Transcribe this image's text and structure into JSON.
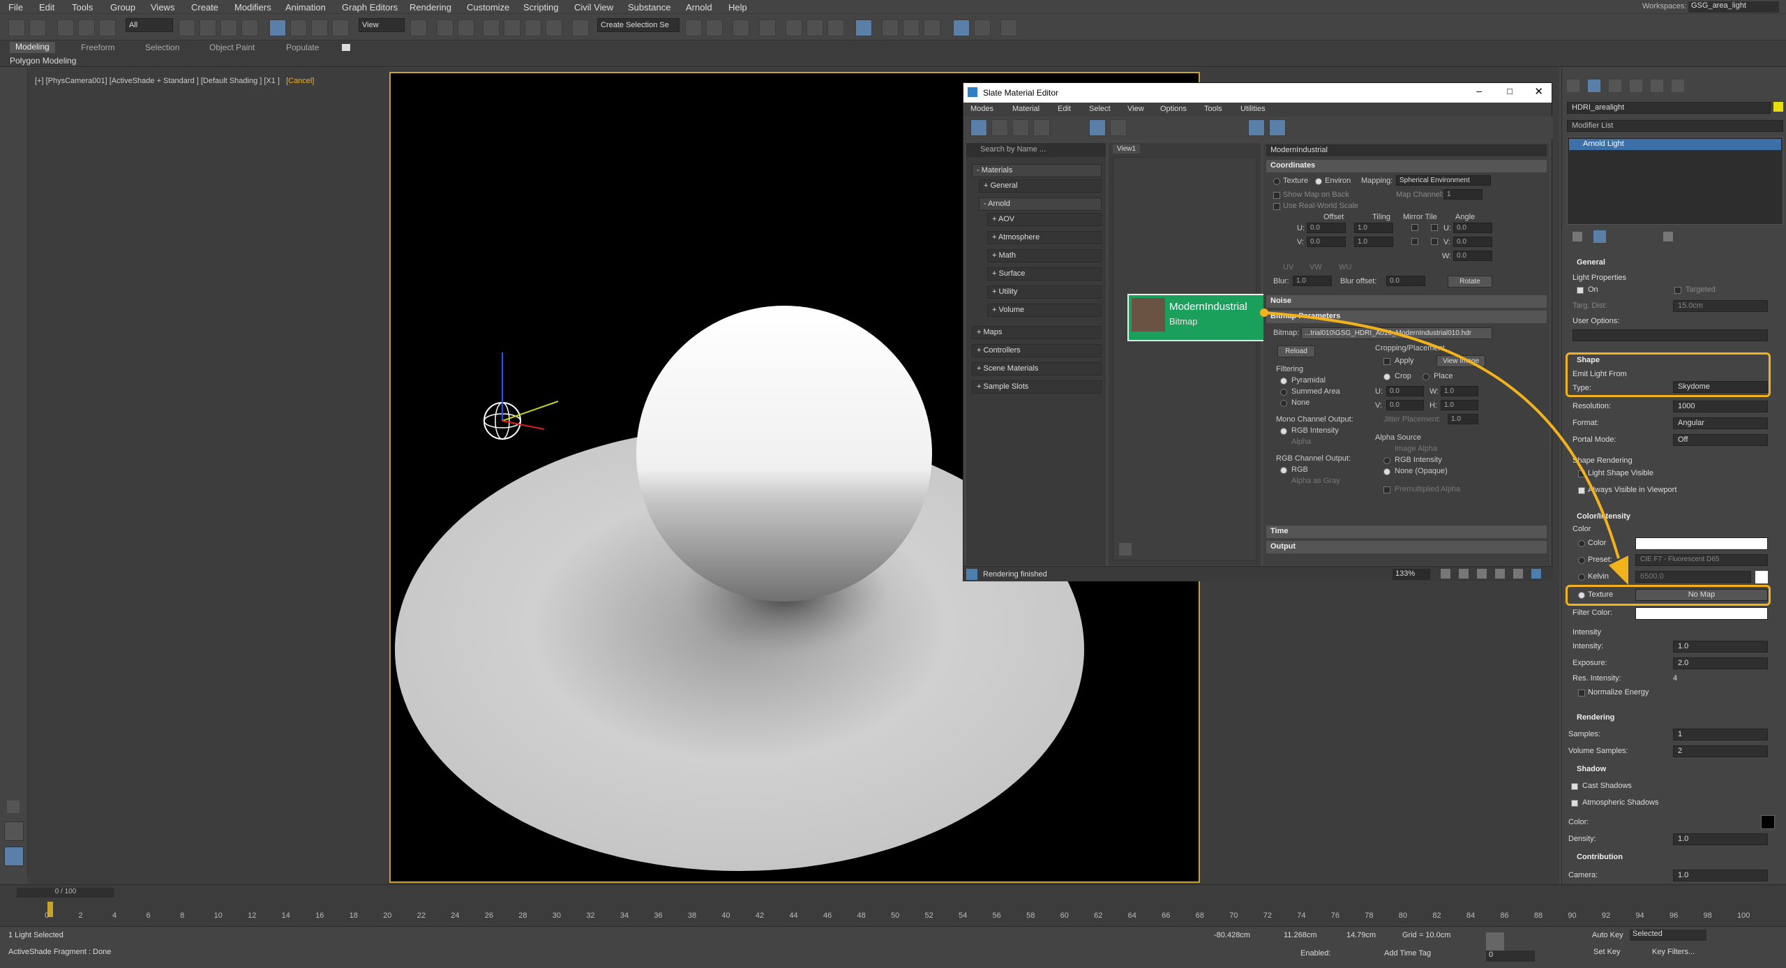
{
  "menu": [
    "File",
    "Edit",
    "Tools",
    "Group",
    "Views",
    "Create",
    "Modifiers",
    "Animation",
    "Graph Editors",
    "Rendering",
    "Customize",
    "Scripting",
    "Civil View",
    "Substance",
    "Arnold",
    "Help"
  ],
  "workspace": {
    "label": "Workspaces:",
    "value": "GSG_area_light"
  },
  "toolbar": {
    "filter": "All",
    "view": "View",
    "selection_set": "Create Selection Se"
  },
  "ribbon": {
    "tabs": [
      "Modeling",
      "Freeform",
      "Selection",
      "Object Paint",
      "Populate"
    ],
    "sub": "Polygon Modeling"
  },
  "viewport": {
    "label": "[+] [PhysCamera001] [ActiveShade + Standard ] [Default Shading ] [X1 ]",
    "cancel": "[Cancel]"
  },
  "sme": {
    "title": "Slate Material Editor",
    "menus": [
      "Modes",
      "Material",
      "Edit",
      "Select",
      "View",
      "Options",
      "Tools",
      "Utilities"
    ],
    "search": "Search by Name ...",
    "view_tab": "View1",
    "browser": {
      "root": "- Materials",
      "items": [
        "+ General",
        "- Arnold",
        "+ AOV",
        "+ Atmosphere",
        "+ Math",
        "+ Surface",
        "+ Utility",
        "+ Volume",
        "+ Maps",
        "+ Controllers",
        "+ Scene Materials",
        "+ Sample Slots"
      ]
    },
    "node": {
      "name": "ModernIndustrial",
      "type": "Bitmap"
    },
    "props": {
      "header": "ModernIndustrial",
      "coordinates": "Coordinates",
      "texture": "Texture",
      "environ": "Environ",
      "mapping_label": "Mapping:",
      "mapping": "Spherical Environment",
      "show_map": "Show Map on Back",
      "map_channel": "Map Channel:",
      "map_channel_val": "1",
      "real_world": "Use Real-World Scale",
      "cols": [
        "Offset",
        "Tiling",
        "Mirror Tile",
        "Angle"
      ],
      "u": "U:",
      "v": "V:",
      "w": "W:",
      "u_off": "0.0",
      "v_off": "0.0",
      "u_til": "1.0",
      "v_til": "1.0",
      "u_ang": "0.0",
      "v_ang": "0.0",
      "w_ang": "0.0",
      "uv": "UV",
      "vw": "VW",
      "wu": "WU",
      "blur": "Blur:",
      "blur_val": "1.0",
      "blur_off": "Blur offset:",
      "blur_off_val": "0.0",
      "rotate": "Rotate",
      "noise": "Noise",
      "bitmap_params": "Bitmap Parameters",
      "bitmap": "Bitmap:",
      "bitmap_path": "...trial010\\GSG_HDRI_A010_ModernIndustrial010.hdr",
      "reload": "Reload",
      "cropping": "Cropping/Placement",
      "apply": "Apply",
      "view_image": "View Image",
      "crop": "Crop",
      "place": "Place",
      "cu": "U:",
      "cu_val": "0.0",
      "cw": "W:",
      "cw_val": "1.0",
      "cv": "V:",
      "cv_val": "0.0",
      "ch": "H:",
      "ch_val": "1.0",
      "jitter": "Jitter Placement:",
      "jitter_val": "1.0",
      "filtering": "Filtering",
      "pyramidal": "Pyramidal",
      "summed": "Summed Area",
      "none": "None",
      "mono": "Mono Channel Output:",
      "rgb_int": "RGB Intensity",
      "alpha": "Alpha",
      "rgb_out": "RGB Channel Output:",
      "rgb": "RGB",
      "alpha_gray": "Alpha as Gray",
      "alpha_src": "Alpha Source",
      "image_alpha": "Image Alpha",
      "rgb_int2": "RGB Intensity",
      "none_opaque": "None (Opaque)",
      "premult": "Premultiplied Alpha",
      "time": "Time",
      "output": "Output"
    },
    "status": "Rendering finished",
    "zoom": "133%"
  },
  "cmd": {
    "object": "HDRI_arealight",
    "modifier_list": "Modifier List",
    "stack_item": "Arnold Light",
    "general": "General",
    "light_props": "Light Properties",
    "on": "On",
    "targeted": "Targeted",
    "targ_dist": "Targ. Dist:",
    "targ_dist_val": "15.0cm",
    "user_options": "User Options:",
    "shape": "Shape",
    "emit": "Emit Light From",
    "type_label": "Type:",
    "type": "Skydome",
    "resolution": "Resolution:",
    "resolution_val": "1000",
    "format": "Format:",
    "format_val": "Angular",
    "portal": "Portal Mode:",
    "portal_val": "Off",
    "shape_rendering": "Shape Rendering",
    "light_shape_visible": "Light Shape Visible",
    "always_visible": "Always Visible in Viewport",
    "color_intensity": "Color/Intensity",
    "color_sub": "Color",
    "color": "Color",
    "preset": "Preset:",
    "preset_val": "CIE F7 - Fluorescent D65",
    "kelvin": "Kelvin",
    "kelvin_val": "6500.0",
    "texture": "Texture",
    "no_map": "No Map",
    "filter_color": "Filter Color:",
    "intensity_sub": "Intensity",
    "intensity": "Intensity:",
    "intensity_val": "1.0",
    "exposure": "Exposure:",
    "exposure_val": "2.0",
    "res_intensity": "Res. Intensity:",
    "res_intensity_val": "4",
    "normalize": "Normalize Energy",
    "rendering": "Rendering",
    "samples": "Samples:",
    "samples_val": "1",
    "vol_samples": "Volume Samples:",
    "vol_samples_val": "2",
    "shadow": "Shadow",
    "cast": "Cast Shadows",
    "atmos": "Atmospheric Shadows",
    "sh_color": "Color:",
    "density": "Density:",
    "density_val": "1.0",
    "contribution": "Contribution",
    "camera": "Camera:",
    "camera_val": "1.0"
  },
  "timeline": {
    "frame": "0 / 100",
    "ticks": [
      "0",
      "2",
      "4",
      "6",
      "8",
      "10",
      "12",
      "14",
      "16",
      "18",
      "20",
      "22",
      "24",
      "26",
      "28",
      "30",
      "32",
      "34",
      "36",
      "38",
      "40",
      "42",
      "44",
      "46",
      "48",
      "50",
      "52",
      "54",
      "56",
      "58",
      "60",
      "62",
      "64",
      "66",
      "68",
      "70",
      "72",
      "74",
      "76",
      "78",
      "80",
      "82",
      "84",
      "86",
      "88",
      "90",
      "92",
      "94",
      "96",
      "98",
      "100"
    ]
  },
  "status": {
    "selected": "1 Light Selected",
    "fragment": "ActiveShade Fragment : Done",
    "x": "-80.428cm",
    "y": "11.268cm",
    "z": "14.79cm",
    "grid": "Grid = 10.0cm",
    "enabled": "Enabled:",
    "add_time_tag": "Add Time Tag",
    "auto_key": "Auto Key",
    "selected_dd": "Selected",
    "set_key": "Set Key",
    "key_filters": "Key Filters...",
    "frame_val": "0"
  },
  "colors": {
    "accent": "#f2b21b",
    "node_green": "#1aa05a",
    "safe_frame": "#c8a52a"
  }
}
